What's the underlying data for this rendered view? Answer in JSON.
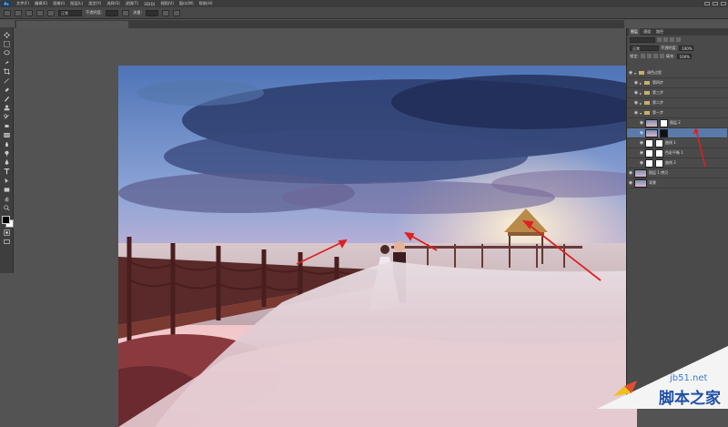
{
  "app": {
    "logo": "Ps"
  },
  "menubar": {
    "items": [
      "文件(F)",
      "编辑(E)",
      "图像(I)",
      "图层(L)",
      "类型(Y)",
      "选择(S)",
      "滤镜(T)",
      "3D(D)",
      "视图(V)",
      "窗口(W)",
      "帮助(H)"
    ]
  },
  "options": {
    "mode_label": "正常",
    "opacity_label": "不透明度:",
    "flow_label": "流量:"
  },
  "panel": {
    "tabs": [
      "图层",
      "通道",
      "路径"
    ],
    "blend_mode": "正常",
    "opacity_label": "不透明度:",
    "opacity_value": "100%",
    "lock_label": "锁定:",
    "fill_label": "填充:",
    "fill_value": "100%",
    "layers": [
      {
        "name": "调色过程",
        "kind": "group",
        "open": true
      },
      {
        "name": "第四步",
        "kind": "group",
        "open": false
      },
      {
        "name": "第三步",
        "kind": "group",
        "open": false
      },
      {
        "name": "第二步",
        "kind": "group",
        "open": false
      },
      {
        "name": "第一步",
        "kind": "group",
        "open": true
      },
      {
        "name": "图层 2",
        "kind": "layer"
      },
      {
        "name": "",
        "kind": "layer",
        "selected": true
      },
      {
        "name": "曲线 1",
        "kind": "adjust"
      },
      {
        "name": "色彩平衡 1",
        "kind": "adjust"
      },
      {
        "name": "曲线 2",
        "kind": "adjust"
      },
      {
        "name": "图层 1 拷贝",
        "kind": "layer"
      },
      {
        "name": "背景",
        "kind": "layer"
      }
    ]
  },
  "watermark": {
    "site": "jb51.net",
    "name": "脚本之家"
  },
  "colors": {
    "annotation_arrow": "#e02020",
    "selection": "#5a7aa8"
  }
}
